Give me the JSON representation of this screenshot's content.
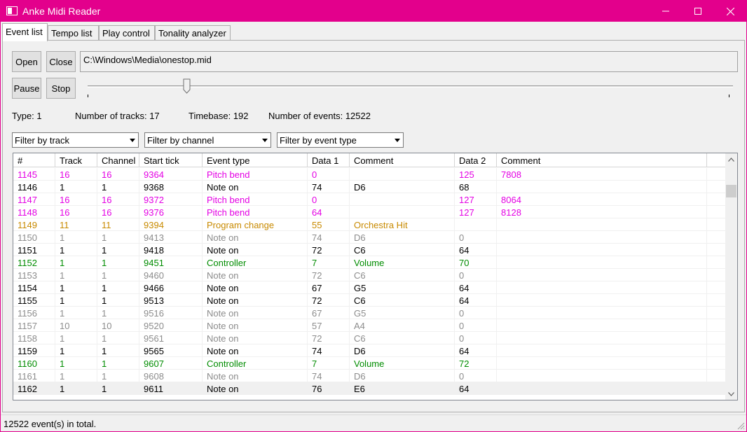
{
  "window": {
    "title": "Anke Midi Reader",
    "accent": "#e3008c"
  },
  "tabs": [
    "Event list",
    "Tempo list",
    "Play control",
    "Tonality analyzer"
  ],
  "controls": {
    "open": "Open",
    "close": "Close",
    "pause": "Pause",
    "stop": "Stop",
    "file_path": "C:\\Windows\\Media\\onestop.mid",
    "playback_position": 0.15
  },
  "info": {
    "type": "Type: 1",
    "tracks": "Number of tracks: 17",
    "timebase": "Timebase: 192",
    "events": "Number of events: 12522"
  },
  "filters": {
    "track": "Filter by track",
    "channel": "Filter by channel",
    "event_type": "Filter by event type"
  },
  "table": {
    "columns": [
      "#",
      "Track",
      "Channel",
      "Start tick",
      "Event type",
      "Data 1",
      "Comment",
      "Data 2",
      "Comment"
    ],
    "colors": {
      "magenta": "#e400e4",
      "black": "#000000",
      "orange": "#c88a00",
      "gray": "#8c8c8c",
      "green": "#008c00"
    },
    "rows": [
      {
        "c": [
          "1145",
          "16",
          "16",
          "9364",
          "Pitch bend",
          "0",
          "",
          "125",
          "7808"
        ],
        "color": "magenta"
      },
      {
        "c": [
          "1146",
          "1",
          "1",
          "9368",
          "Note on",
          "74",
          "D6",
          "68",
          ""
        ],
        "color": "black"
      },
      {
        "c": [
          "1147",
          "16",
          "16",
          "9372",
          "Pitch bend",
          "0",
          "",
          "127",
          "8064"
        ],
        "color": "magenta"
      },
      {
        "c": [
          "1148",
          "16",
          "16",
          "9376",
          "Pitch bend",
          "64",
          "",
          "127",
          "8128"
        ],
        "color": "magenta"
      },
      {
        "c": [
          "1149",
          "11",
          "11",
          "9394",
          "Program change",
          "55",
          "Orchestra Hit",
          "",
          ""
        ],
        "color": "orange"
      },
      {
        "c": [
          "1150",
          "1",
          "1",
          "9413",
          "Note on",
          "74",
          "D6",
          "0",
          ""
        ],
        "color": "gray"
      },
      {
        "c": [
          "1151",
          "1",
          "1",
          "9418",
          "Note on",
          "72",
          "C6",
          "64",
          ""
        ],
        "color": "black"
      },
      {
        "c": [
          "1152",
          "1",
          "1",
          "9451",
          "Controller",
          "7",
          "Volume",
          "70",
          ""
        ],
        "color": "green"
      },
      {
        "c": [
          "1153",
          "1",
          "1",
          "9460",
          "Note on",
          "72",
          "C6",
          "0",
          ""
        ],
        "color": "gray"
      },
      {
        "c": [
          "1154",
          "1",
          "1",
          "9466",
          "Note on",
          "67",
          "G5",
          "64",
          ""
        ],
        "color": "black"
      },
      {
        "c": [
          "1155",
          "1",
          "1",
          "9513",
          "Note on",
          "72",
          "C6",
          "64",
          ""
        ],
        "color": "black"
      },
      {
        "c": [
          "1156",
          "1",
          "1",
          "9516",
          "Note on",
          "67",
          "G5",
          "0",
          ""
        ],
        "color": "gray"
      },
      {
        "c": [
          "1157",
          "10",
          "10",
          "9520",
          "Note on",
          "57",
          "A4",
          "0",
          ""
        ],
        "color": "gray"
      },
      {
        "c": [
          "1158",
          "1",
          "1",
          "9561",
          "Note on",
          "72",
          "C6",
          "0",
          ""
        ],
        "color": "gray"
      },
      {
        "c": [
          "1159",
          "1",
          "1",
          "9565",
          "Note on",
          "74",
          "D6",
          "64",
          ""
        ],
        "color": "black"
      },
      {
        "c": [
          "1160",
          "1",
          "1",
          "9607",
          "Controller",
          "7",
          "Volume",
          "72",
          ""
        ],
        "color": "green"
      },
      {
        "c": [
          "1161",
          "1",
          "1",
          "9608",
          "Note on",
          "74",
          "D6",
          "0",
          ""
        ],
        "color": "gray"
      },
      {
        "c": [
          "1162",
          "1",
          "1",
          "9611",
          "Note on",
          "76",
          "E6",
          "64",
          ""
        ],
        "color": "black",
        "hover": true
      }
    ]
  },
  "status": {
    "text": "12522 event(s) in total."
  }
}
